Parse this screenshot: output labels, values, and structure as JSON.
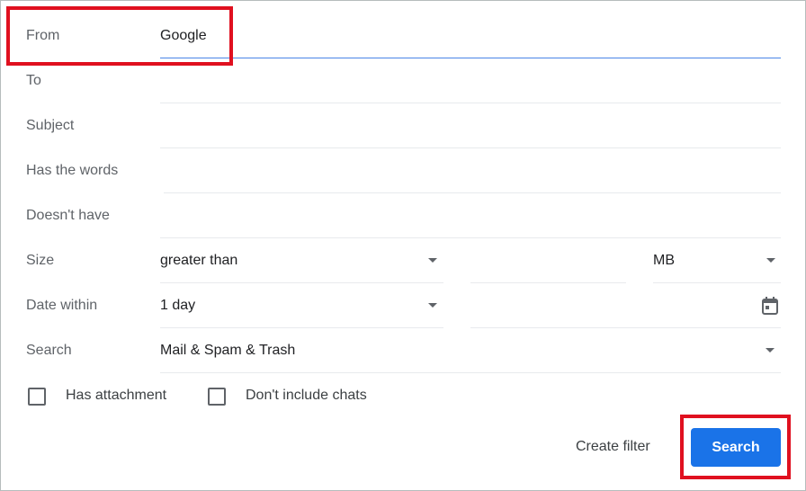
{
  "form": {
    "from": {
      "label": "From",
      "value": "Google"
    },
    "to": {
      "label": "To",
      "value": ""
    },
    "subject": {
      "label": "Subject",
      "value": ""
    },
    "has_words": {
      "label": "Has the words",
      "value": ""
    },
    "doesnt_have": {
      "label": "Doesn't have",
      "value": ""
    },
    "size": {
      "label": "Size",
      "comparator": "greater than",
      "amount": "",
      "unit": "MB"
    },
    "date_within": {
      "label": "Date within",
      "value": "1 day",
      "date": ""
    },
    "search": {
      "label": "Search",
      "value": "Mail & Spam & Trash"
    },
    "has_attachment": {
      "label": "Has attachment",
      "checked": false
    },
    "no_chats": {
      "label": "Don't include chats",
      "checked": false
    }
  },
  "actions": {
    "create_filter": "Create filter",
    "search": "Search"
  },
  "colors": {
    "accent": "#1a73e8",
    "highlight": "#e0101f"
  }
}
